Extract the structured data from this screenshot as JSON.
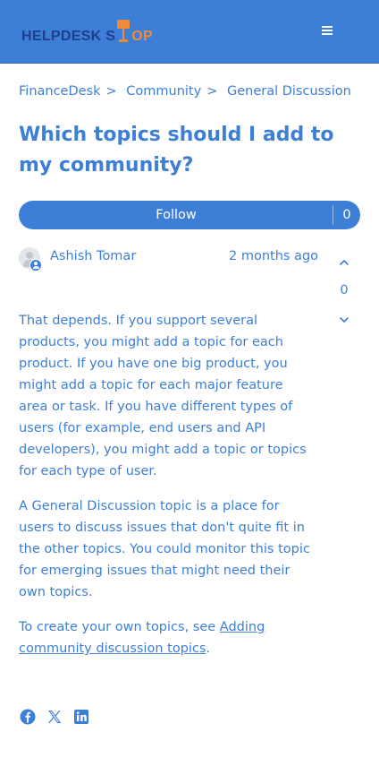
{
  "header": {
    "logo_part1": "HELPDESK S",
    "logo_part2": "OP",
    "menu_icon": "hamburger-menu-icon"
  },
  "breadcrumb": {
    "items": [
      "FinanceDesk",
      "Community",
      "General Discussion"
    ],
    "separator": ">"
  },
  "post": {
    "title": "Which topics should I add to my community?",
    "follow_label": "Follow",
    "follow_count": "0",
    "author": "Ashish Tomar",
    "time": "2 months ago",
    "vote_count": "0",
    "paragraphs": [
      "That depends. If you support several products, you might add a topic for each product. If you have one big product, you might add a topic for each major feature area or task. If you have different types of users (for example, end users and API developers), you might add a topic or topics for each type of user.",
      "A General Discussion topic is a place for users to discuss issues that don't quite fit in the other topics. You could monitor this topic for emerging issues that might need their own topics."
    ],
    "link_prefix": "To create your own topics, see ",
    "link_text": "Adding community discussion topics",
    "link_suffix": "."
  },
  "share_icons": [
    "facebook-icon",
    "x-twitter-icon",
    "linkedin-icon"
  ],
  "colors": {
    "brand_blue": "#3d7fd6",
    "logo_navy": "#1e3f8f",
    "logo_orange": "#f08a3a",
    "background": "#ffffff"
  }
}
